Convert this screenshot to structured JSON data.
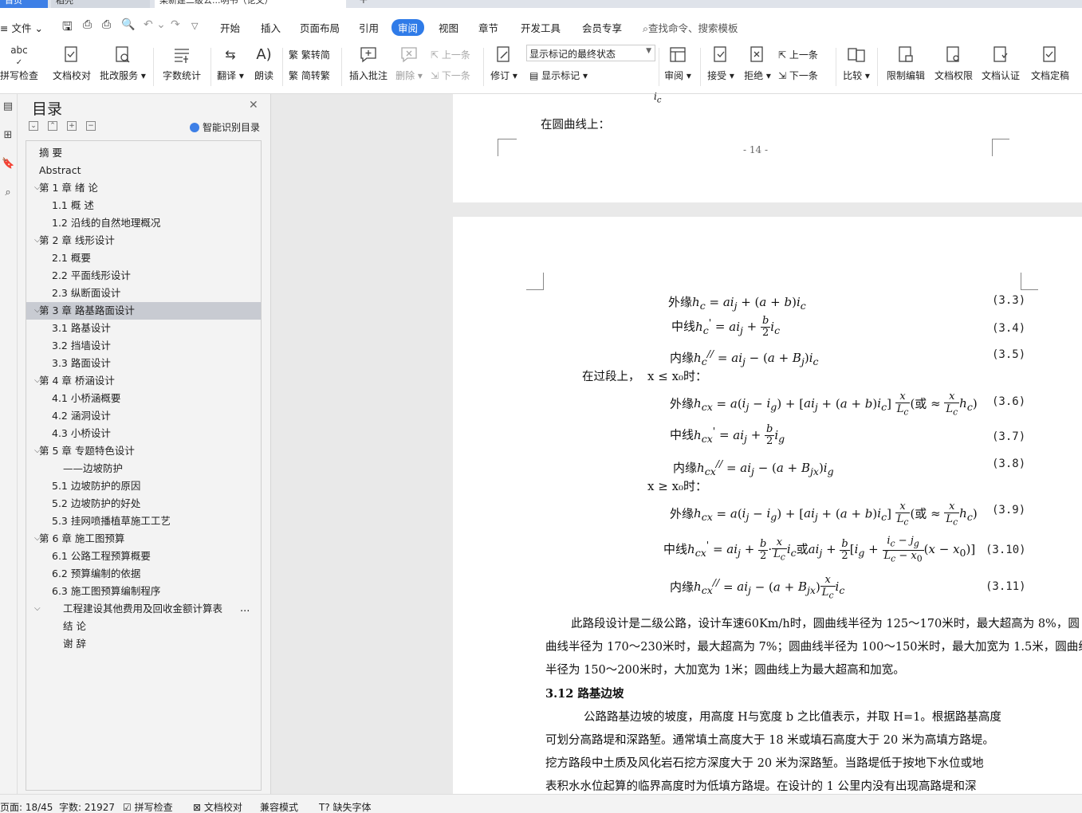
{
  "tabs": [
    {
      "label": "首页"
    },
    {
      "label": "稻壳"
    },
    {
      "label": "某新建二级公...明书（论文）"
    }
  ],
  "menu": {
    "file": "文件",
    "items": [
      "开始",
      "插入",
      "页面布局",
      "引用",
      "审阅",
      "视图",
      "章节",
      "开发工具",
      "会员专享"
    ],
    "active": "审阅",
    "search_placeholder": "查找命令、搜索模板"
  },
  "ribbon": {
    "spell": "拼写检查",
    "proof": "文档校对",
    "review_service": "批改服务",
    "word_count": "字数统计",
    "translate": "翻译",
    "read": "朗读",
    "trad": "繁转简",
    "simp": "简转繁",
    "insert_comment": "插入批注",
    "delete": "删除",
    "prev": "上一条",
    "next": "下一条",
    "revise": "修订",
    "markup_state": "显示标记的最终状态",
    "show_markup": "显示标记",
    "review_pane": "审阅",
    "accept": "接受",
    "reject": "拒绝",
    "prev2": "上一条",
    "next2": "下一条",
    "compare": "比较",
    "restrict": "限制编辑",
    "permission": "文档权限",
    "certify": "文档认证",
    "finalize": "文档定稿"
  },
  "toc": {
    "title": "目录",
    "smart_label": "智能识别目录",
    "items": [
      {
        "label": "摘  要",
        "level": 1,
        "caret": false
      },
      {
        "label": "Abstract",
        "level": 1,
        "caret": false
      },
      {
        "label": "第 1 章  绪  论",
        "level": 1,
        "caret": true
      },
      {
        "label": "1.1    概    述",
        "level": 2,
        "caret": false
      },
      {
        "label": "1.2    沿线的自然地理概况",
        "level": 2,
        "caret": false
      },
      {
        "label": "第 2 章  线形设计",
        "level": 1,
        "caret": true
      },
      {
        "label": "2.1 概要",
        "level": 2,
        "caret": false
      },
      {
        "label": "2.2 平面线形设计",
        "level": 2,
        "caret": false
      },
      {
        "label": "2.3  纵断面设计",
        "level": 2,
        "caret": false
      },
      {
        "label": "第 3 章  路基路面设计",
        "level": 1,
        "caret": true,
        "selected": true
      },
      {
        "label": "3.1  路基设计",
        "level": 2,
        "caret": false
      },
      {
        "label": "3.2    挡墙设计",
        "level": 2,
        "caret": false
      },
      {
        "label": "3.3    路面设计",
        "level": 2,
        "caret": false
      },
      {
        "label": "第 4 章  桥涵设计",
        "level": 1,
        "caret": true
      },
      {
        "label": "4.1 小桥涵概要",
        "level": 2,
        "caret": false
      },
      {
        "label": "4.2 涵洞设计",
        "level": 2,
        "caret": false
      },
      {
        "label": "4.3 小桥设计",
        "level": 2,
        "caret": false
      },
      {
        "label": "第 5 章    专题特色设计",
        "level": 1,
        "caret": true
      },
      {
        "label": "——边坡防护",
        "level": 3,
        "caret": false
      },
      {
        "label": "5.1 边坡防护的原因",
        "level": 2,
        "caret": false
      },
      {
        "label": "5.2 边坡防护的好处",
        "level": 2,
        "caret": false
      },
      {
        "label": "5.3 挂网喷播植草施工工艺",
        "level": 2,
        "caret": false
      },
      {
        "label": "第 6 章  施工图预算",
        "level": 1,
        "caret": true
      },
      {
        "label": "6.1 公路工程预算概要",
        "level": 2,
        "caret": false
      },
      {
        "label": "6.2 预算编制的依据",
        "level": 2,
        "caret": false
      },
      {
        "label": "6.3 施工图预算编制程序",
        "level": 2,
        "caret": false
      },
      {
        "label": "工程建设其他费用及回收金额计算表",
        "level": 2.5,
        "caret": true,
        "more": "..."
      },
      {
        "label": "结  论",
        "level": 2.5,
        "caret": false
      },
      {
        "label": "谢  辞",
        "level": 2.5,
        "caret": false
      }
    ]
  },
  "doc": {
    "top_line": "在圆曲线上：",
    "page_number": "- 14 -",
    "eq_labels": [
      "外缘",
      "中线",
      "内缘",
      "外缘",
      "中线",
      "内缘",
      "外缘",
      "中线",
      "内缘"
    ],
    "eq_numbers": [
      "(3.3)",
      "(3.4)",
      "(3.5)",
      "(3.6)",
      "(3.7)",
      "(3.8)",
      "(3.9)",
      "(3.10)",
      "(3.11)"
    ],
    "transition_text": "在过段上，",
    "cond1": "x ≤ x₀时：",
    "cond2": "x ≥ x₀时：",
    "or_text": "或",
    "para1_line1": "此路段设计是二级公路，设计车速60Km/h时，圆曲线半径为 125～170米时，最大超高为 8%，圆",
    "para1_line2": "曲线半径为 170～230米时，最大超高为 7%；圆曲线半径为 100～150米时，最大加宽为 1.5米，圆曲线",
    "para1_line3": "半径为 150～200米时，大加宽为 1米；圆曲线上为最大超高和加宽。",
    "heading": "3.12 路基边坡",
    "para2_line1": "公路路基边坡的坡度，用高度 H与宽度 b 之比值表示，并取 H=1。根据路基高度",
    "para2_line2": "可划分高路堤和深路堑。通常填土高度大于 18 米或填石高度大于 20 米为高填方路堤。",
    "para2_line3": "挖方路段中土质及风化岩石挖方深度大于 20 米为深路堑。当路堤低于按地下水位或地",
    "para2_line4": "表积水水位起算的临界高度时为低填方路堤。在设计的 1 公里内没有出现高路堤和深"
  },
  "status": {
    "page": "页面: 18/45",
    "words": "字数: 21927",
    "spell": "拼写检查",
    "proof": "文档校对",
    "compat": "兼容模式",
    "font": "缺失字体"
  },
  "colors": {
    "accent": "#2f7be8",
    "selected_row": "#c8cbd2"
  }
}
